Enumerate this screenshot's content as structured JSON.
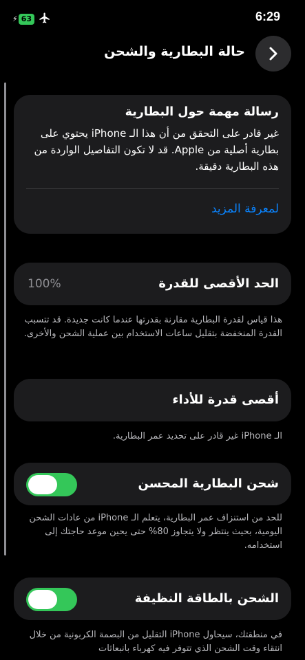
{
  "status_bar": {
    "battery_level": "63",
    "time": "6:29",
    "icons": [
      "charging-bolt-icon",
      "airplane-icon"
    ]
  },
  "nav": {
    "title": "حالة البطارية والشحن",
    "back_icon": "chevron-right-icon"
  },
  "alert": {
    "title": "رسالة مهمة حول البطارية",
    "body": "غير قادر على التحقق من أن هذا الـ iPhone يحتوي على بطارية أصلية من Apple. قد لا تكون التفاصيل الواردة من هذه البطارية دقيقة.",
    "link": "لمعرفة المزيد"
  },
  "max_capacity": {
    "label": "الحد الأقصى للقدرة",
    "value": "100%",
    "footnote": "هذا قياس لقدرة البطارية مقارنة بقدرتها عندما كانت جديدة. قد تتسبب القدرة المنخفضة بتقليل ساعات الاستخدام بين عملية الشحن والأخرى."
  },
  "peak_performance": {
    "label": "أقصى قدرة للأداء",
    "footnote": "الـ iPhone غير قادر على تحديد عمر البطارية."
  },
  "optimized_charging": {
    "label": "شحن البطارية المحسن",
    "enabled": true,
    "footnote": "للحد من استنزاف عمر البطارية، يتعلم الـ iPhone من عادات الشحن اليومية، بحيث ينتظر ولا يتجاوز 80% حتى يحين موعد حاجتك إلى استخدامه."
  },
  "clean_energy": {
    "label": "الشحن بالطاقة النظيفة",
    "enabled": true,
    "footnote": "في منطقتك، سيحاول iPhone التقليل من البصمة الكربونية من خلال انتقاء وقت الشحن الذي تتوفر فيه كهرباء بانبعاثات"
  },
  "colors": {
    "background": "#000000",
    "card": "#1c1c1e",
    "accent_link": "#0a84ff",
    "toggle_on": "#34c759"
  }
}
